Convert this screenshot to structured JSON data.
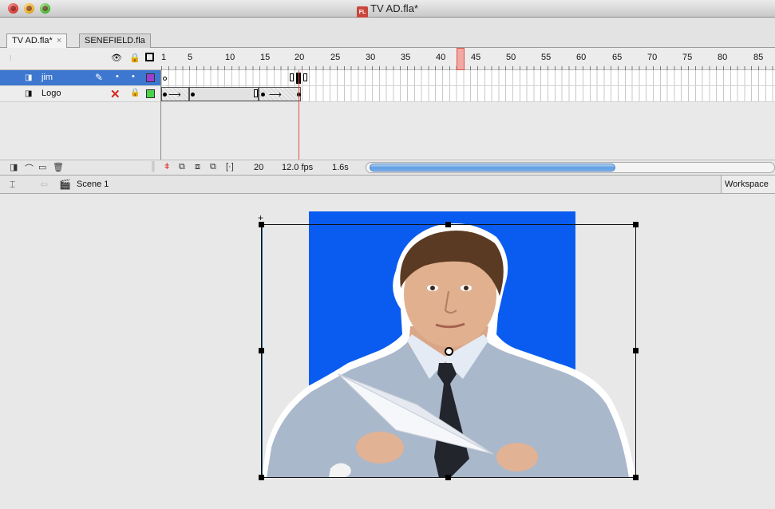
{
  "window": {
    "title": "TV AD.fla*",
    "file_icon": "FL"
  },
  "tabs": [
    {
      "label": "TV AD.fla*",
      "close": "×"
    },
    {
      "label": "SENEFIELD.fla"
    }
  ],
  "timeline": {
    "ruler_numbers": [
      "1",
      "5",
      "10",
      "15",
      "20",
      "25",
      "30",
      "35",
      "40",
      "45",
      "50",
      "55",
      "60",
      "65",
      "70",
      "75",
      "80",
      "85"
    ],
    "layers": [
      {
        "name": "jim",
        "selected": true,
        "color": "#9b3fd1"
      },
      {
        "name": "Logo",
        "selected": false,
        "color": "#4bd44b"
      }
    ],
    "current_frame": "20",
    "fps": "12.0 fps",
    "elapsed": "1.6s"
  },
  "editbar": {
    "scene": "Scene 1",
    "workspace": "Workspace"
  },
  "stage": {
    "background_color": "#0a5cf0"
  }
}
